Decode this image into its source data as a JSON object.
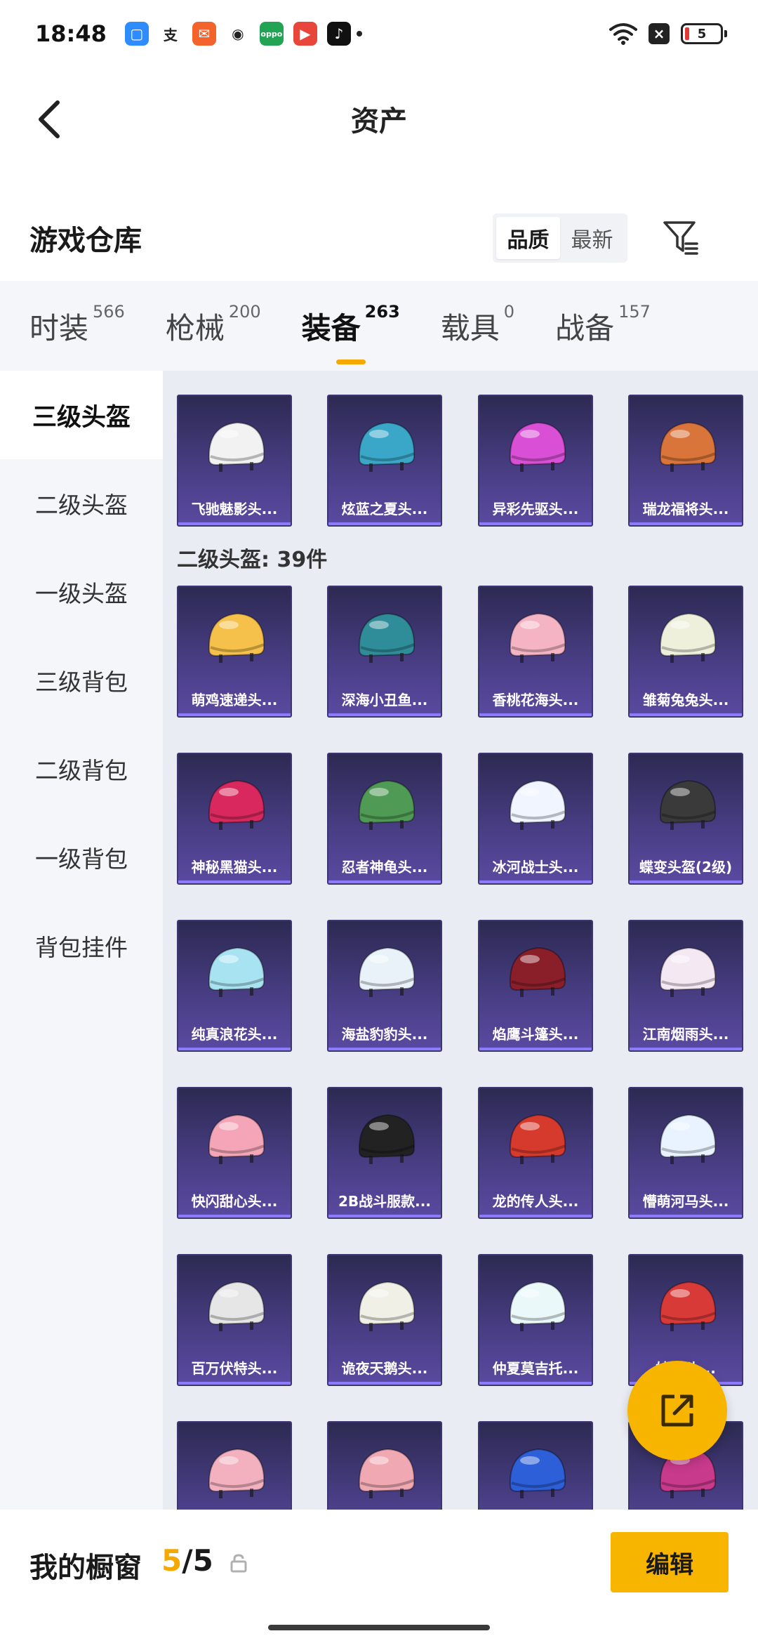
{
  "status_bar": {
    "time": "18:48",
    "apps": [
      {
        "name": "files-app-icon",
        "glyph": "▢",
        "color": "#2f8cff"
      },
      {
        "name": "alipay-icon",
        "glyph": "支",
        "color": "#ffffff"
      },
      {
        "name": "mail-app-icon",
        "glyph": "✉",
        "color": "#f2642c"
      },
      {
        "name": "wechat-icon",
        "glyph": "◉",
        "color": "#ffffff"
      },
      {
        "name": "oppo-app-icon",
        "glyph": "oppo",
        "color": "#23a455"
      },
      {
        "name": "video-app-icon",
        "glyph": "▶",
        "color": "#e8463b"
      },
      {
        "name": "tiktok-icon",
        "glyph": "♪",
        "color": "#111111"
      }
    ],
    "battery": "5"
  },
  "header": {
    "title": "资产"
  },
  "section": {
    "title": "游戏仓库",
    "sort_options": [
      "品质",
      "最新"
    ],
    "active_sort": "品质"
  },
  "category_tabs": [
    {
      "label": "时装",
      "count": "566"
    },
    {
      "label": "枪械",
      "count": "200"
    },
    {
      "label": "装备",
      "count": "263",
      "active": true
    },
    {
      "label": "载具",
      "count": "0"
    },
    {
      "label": "战备",
      "count": "157"
    }
  ],
  "sidebar": {
    "items": [
      "三级头盔",
      "二级头盔",
      "一级头盔",
      "三级背包",
      "二级背包",
      "一级背包",
      "背包挂件"
    ],
    "active_index": 0
  },
  "content": {
    "group_header": "二级头盔: 39件",
    "rows": [
      [
        "飞驰魅影头...",
        "炫蓝之夏头...",
        "异彩先驱头...",
        "瑞龙福将头..."
      ],
      [
        "萌鸡速递头...",
        "深海小丑鱼...",
        "香桃花海头...",
        "雏菊兔兔头..."
      ],
      [
        "神秘黑猫头...",
        "忍者神龟头...",
        "冰河战士头...",
        "蝶变头盔(2级)"
      ],
      [
        "纯真浪花头...",
        "海盐豹豹头...",
        "焰鹰斗篷头...",
        "江南烟雨头..."
      ],
      [
        "快闪甜心头...",
        "2B战斗服款...",
        "龙的传人头...",
        "懵萌河马头..."
      ],
      [
        "百万伏特头...",
        "诡夜天鹅头...",
        "仲夏莫吉托...",
        "妙...头..."
      ],
      [
        "",
        "",
        "",
        ""
      ]
    ],
    "helmet_colors": [
      [
        "#f2f2f2",
        "#3aa7c9",
        "#d94fd6",
        "#d9743a"
      ],
      [
        "#f6c14a",
        "#2f8c99",
        "#f5b4c4",
        "#eef0dc"
      ],
      [
        "#d8285e",
        "#4f9a55",
        "#f1f5ff",
        "#3a3a3a"
      ],
      [
        "#a8e3f2",
        "#e9f2f8",
        "#8a1f2a",
        "#f4e8f2"
      ],
      [
        "#f4a6b8",
        "#222222",
        "#d63a2c",
        "#e8f3ff"
      ],
      [
        "#e6e6e6",
        "#f0f0e6",
        "#eaf8fa",
        "#d83a38"
      ],
      [
        "#f3b0bf",
        "#f0a8b3",
        "#2d5fd8",
        "#c83a8c"
      ]
    ]
  },
  "bottom_bar": {
    "label": "我的橱窗",
    "count_current": "5",
    "count_sep": "/",
    "count_max": "5",
    "edit_label": "编辑"
  },
  "colors": {
    "accent": "#f7b500",
    "card_bg": "#3f3775",
    "page_bg": "#e9ecf2"
  }
}
